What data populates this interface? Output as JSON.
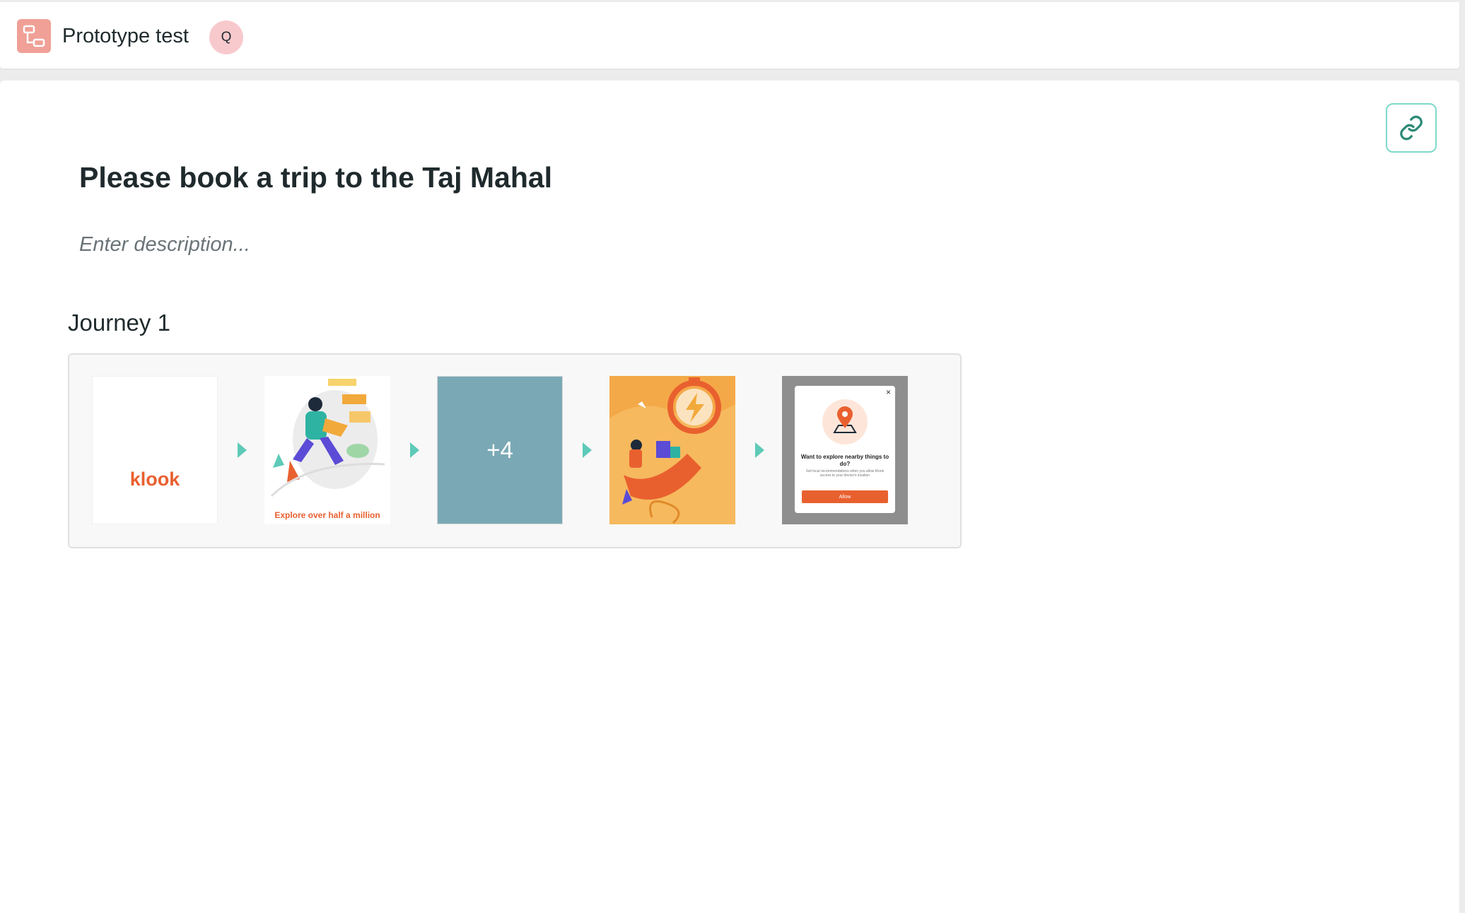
{
  "header": {
    "app_icon": "flow-diagram-icon",
    "title": "Prototype test",
    "avatar_initial": "Q"
  },
  "main": {
    "link_button_icon": "link-icon",
    "task_title": "Please book a trip to the Taj Mahal",
    "description_placeholder": "Enter description...",
    "journey": {
      "label": "Journey 1",
      "screens": [
        {
          "kind": "splash",
          "text": "klook"
        },
        {
          "kind": "onboarding",
          "caption": "Explore over half a million"
        },
        {
          "kind": "more",
          "text": "+4"
        },
        {
          "kind": "illustration"
        },
        {
          "kind": "permission-modal",
          "close": "×",
          "title": "Want to explore nearby things to do?",
          "body": "Get local recommendations when you allow Klook access to your device's location",
          "button": "Allow"
        }
      ]
    }
  },
  "colors": {
    "accent_teal": "#5ecab8",
    "brand_orange": "#e9602f",
    "app_icon_bg": "#f0a096",
    "avatar_bg": "#f7c9cd",
    "more_tile_bg": "#7aa9b5"
  }
}
